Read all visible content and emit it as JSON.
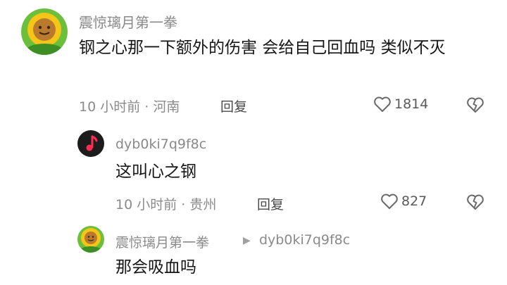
{
  "comment": {
    "username": "震惊璃月第一拳",
    "content": "钢之心那一下额外的伤害 会给自己回血吗 类似不灭",
    "time_location": "10 小时前 · 河南",
    "reply_label": "回复",
    "likes": "1814"
  },
  "reply1": {
    "username": "dyb0ki7q9f8c",
    "content": "这叫心之钢",
    "time_location": "10 小时前 · 贵州",
    "reply_label": "回复",
    "likes": "827"
  },
  "reply2": {
    "username": "震惊璃月第一拳",
    "reply_to": "dyb0ki7q9f8c",
    "content": "那会吸血吗"
  },
  "icons": {
    "like": "heart-outline-icon",
    "dislike": "broken-heart-icon",
    "reply_arrow": "triangle-right-icon"
  },
  "colors": {
    "text": "#161616",
    "meta": "#8a8a8a",
    "avatar_music_bg": "#1c1c1c",
    "avatar_music_note": "#ff2d55"
  }
}
